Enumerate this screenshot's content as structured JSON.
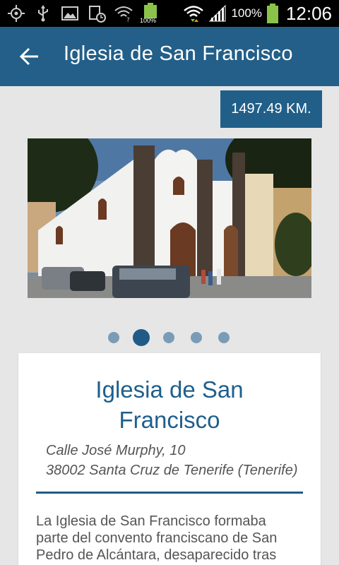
{
  "status_bar": {
    "battery_small_label": "100%",
    "battery_percent": "100%",
    "time": "12:06"
  },
  "app_bar": {
    "title": "Iglesia de San Francisco",
    "back_icon": "arrow-back-icon"
  },
  "distance": "1497.49 KM.",
  "carousel": {
    "page_count": 5,
    "active_index": 1
  },
  "card": {
    "title_line1": "Iglesia de San",
    "title_line2": "Francisco",
    "address_line1": "Calle José Murphy, 10",
    "address_line2": "38002 Santa Cruz de Tenerife (Tenerife)",
    "description_line1": "La Iglesia de San Francisco formaba",
    "description_line2": "parte del convento franciscano de San",
    "description_line3": "Pedro de Alcántara, desaparecido tras"
  },
  "colors": {
    "primary": "#235f88",
    "accent_dot": "#1f5b86",
    "inactive_dot": "#7a9cb6",
    "background": "#e6e6e6"
  }
}
